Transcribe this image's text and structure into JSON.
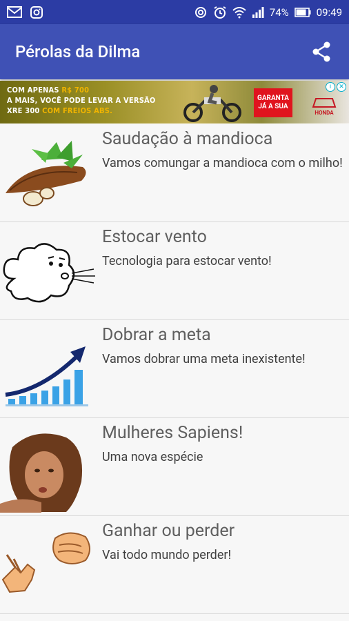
{
  "status_bar": {
    "battery_percent": "74%",
    "time": "09:49"
  },
  "app_bar": {
    "title": "Pérolas da Dilma"
  },
  "ad": {
    "line1_a": "COM APENAS ",
    "line1_b": "R$ 700",
    "line2": "A MAIS, VOCÊ PODE LEVAR A VERSÃO",
    "line3_a": "XRE 300 ",
    "line3_b": "COM FREIOS ABS.",
    "cta": "GARANTA JÁ A SUA",
    "brand": "HONDA"
  },
  "items": [
    {
      "title": "Saudação à mandioca",
      "subtitle": "Vamos comungar a mandioca com o milho!"
    },
    {
      "title": "Estocar vento",
      "subtitle": "Tecnologia para estocar vento!"
    },
    {
      "title": "Dobrar a meta",
      "subtitle": "Vamos dobrar uma meta inexistente!"
    },
    {
      "title": "Mulheres Sapiens!",
      "subtitle": "Uma nova espécie"
    },
    {
      "title": "Ganhar ou perder",
      "subtitle": "Vai todo mundo perder!"
    }
  ],
  "colors": {
    "status_bar": "#2c3ca4",
    "app_bar": "#3f51b5",
    "list_bg": "#f7f7f7",
    "title_text": "#5f5f5f",
    "subtitle_text": "#3f3f3f"
  }
}
